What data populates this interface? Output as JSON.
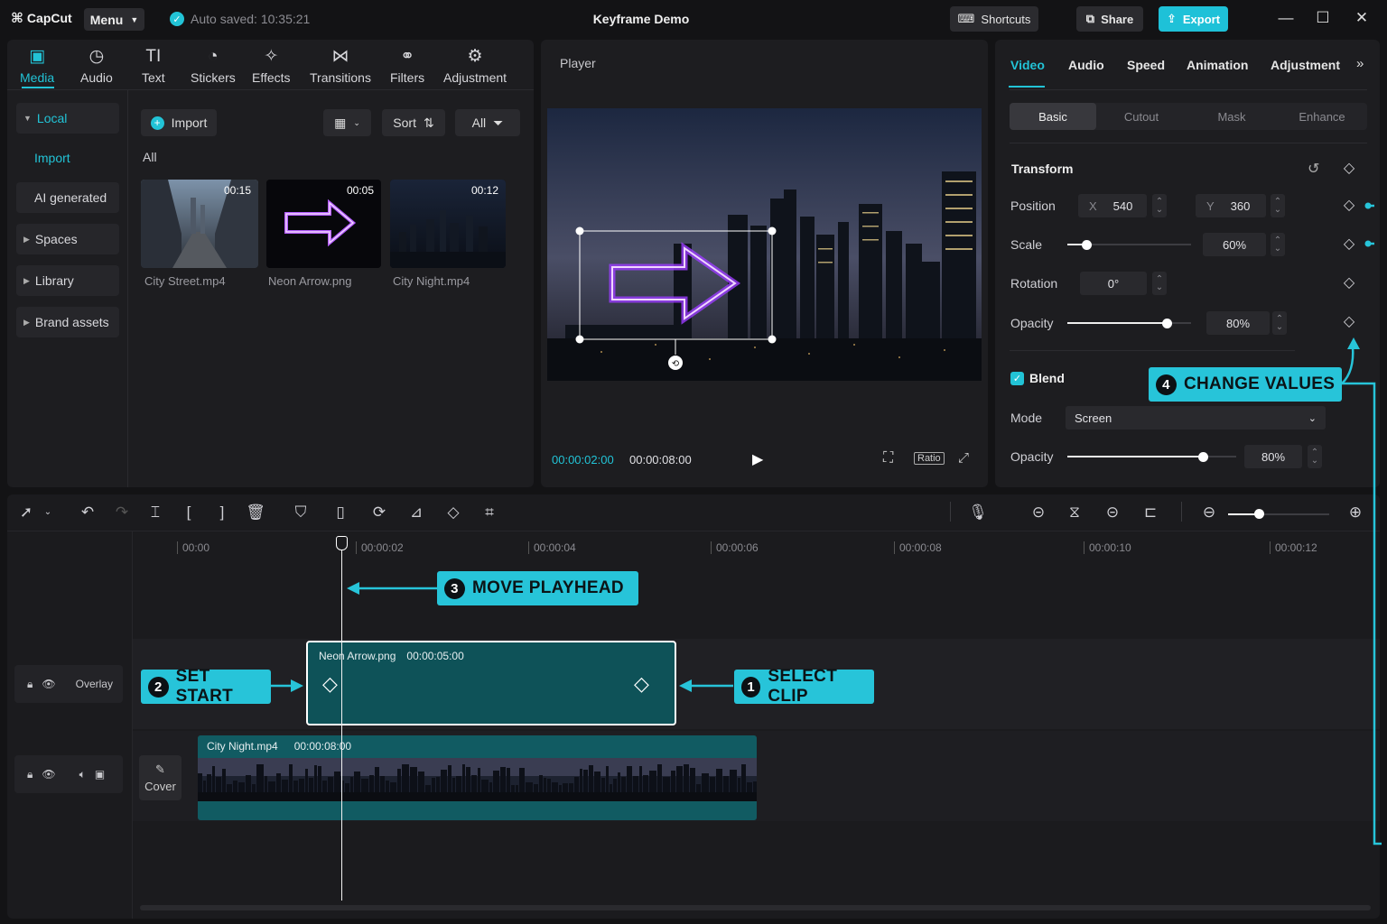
{
  "app": {
    "logo": "CapCut",
    "menu_label": "Menu",
    "autosave": "Auto saved: 10:35:21",
    "title": "Keyframe Demo",
    "shortcuts_label": "Shortcuts",
    "share_label": "Share",
    "export_label": "Export"
  },
  "media": {
    "tabs": [
      {
        "label": "Media",
        "icon": "media-icon"
      },
      {
        "label": "Audio",
        "icon": "audio-icon"
      },
      {
        "label": "Text",
        "icon": "text-icon"
      },
      {
        "label": "Stickers",
        "icon": "sticker-icon"
      },
      {
        "label": "Effects",
        "icon": "effects-icon"
      },
      {
        "label": "Transitions",
        "icon": "transitions-icon"
      },
      {
        "label": "Filters",
        "icon": "filters-icon"
      },
      {
        "label": "Adjustment",
        "icon": "adjustment-icon"
      }
    ],
    "sidebar": {
      "local": "Local",
      "import": "Import",
      "ai": "AI generated",
      "spaces": "Spaces",
      "library": "Library",
      "brand": "Brand assets"
    },
    "import_btn": "Import",
    "sort_label": "Sort",
    "filter_label": "All",
    "section_label": "All",
    "items": [
      {
        "name": "City Street.mp4",
        "duration": "00:15"
      },
      {
        "name": "Neon Arrow.png",
        "duration": "00:05"
      },
      {
        "name": "City Night.mp4",
        "duration": "00:12"
      }
    ]
  },
  "player": {
    "label": "Player",
    "current_time": "00:00:02:00",
    "total_time": "00:00:08:00",
    "ratio_label": "Ratio"
  },
  "properties": {
    "tabs": [
      "Video",
      "Audio",
      "Speed",
      "Animation",
      "Adjustment"
    ],
    "subtabs": [
      "Basic",
      "Cutout",
      "Mask",
      "Enhance"
    ],
    "transform_title": "Transform",
    "position_label": "Position",
    "x_label": "X",
    "x_value": "540",
    "y_label": "Y",
    "y_value": "360",
    "scale_label": "Scale",
    "scale_value": "60%",
    "scale_level": 0.15,
    "rotation_label": "Rotation",
    "rotation_value": "0°",
    "opacity_label": "Opacity",
    "opacity_value": "80%",
    "opacity_level": 0.8,
    "blend_label": "Blend",
    "mode_label": "Mode",
    "mode_value": "Screen",
    "blend_opacity_label": "Opacity",
    "blend_opacity_value": "80%",
    "blend_opacity_level": 0.8
  },
  "timeline": {
    "ruler": [
      "00:00",
      "00:00:02",
      "00:00:04",
      "00:00:06",
      "00:00:08",
      "00:00:10",
      "00:00:12"
    ],
    "overlay_track_label": "Overlay",
    "overlay_clip": {
      "name": "Neon Arrow.png",
      "duration": "00:00:05:00"
    },
    "video_clip": {
      "name": "City Night.mp4",
      "duration": "00:00:08:00"
    },
    "cover_label": "Cover"
  },
  "callouts": {
    "one": {
      "num": "1",
      "text": "SELECT CLIP"
    },
    "two": {
      "num": "2",
      "text": "SET START"
    },
    "three": {
      "num": "3",
      "text": "MOVE PLAYHEAD"
    },
    "four": {
      "num": "4",
      "text": "CHANGE VALUES"
    }
  },
  "colors": {
    "accent": "#22c3d6",
    "callout": "#27c4d9",
    "clip": "#0e5258"
  }
}
